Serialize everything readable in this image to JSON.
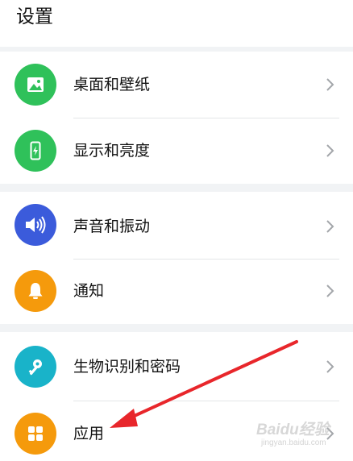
{
  "header": {
    "title": "设置"
  },
  "items": [
    {
      "label": "桌面和壁纸",
      "icon": "image-icon",
      "color": "#2fc15a"
    },
    {
      "label": "显示和亮度",
      "icon": "phone-brightness-icon",
      "color": "#2fc15a"
    },
    {
      "label": "声音和振动",
      "icon": "speaker-icon",
      "color": "#3b5bdb"
    },
    {
      "label": "通知",
      "icon": "bell-icon",
      "color": "#f59a0c"
    },
    {
      "label": "生物识别和密码",
      "icon": "key-icon",
      "color": "#19b3c9"
    },
    {
      "label": "应用",
      "icon": "apps-grid-icon",
      "color": "#f59a0c"
    }
  ],
  "watermark": {
    "brand": "Baidu经验",
    "url": "jingyan.baidu.com"
  },
  "colors": {
    "background": "#f1f3f5",
    "annotation_arrow": "#e8262b"
  }
}
